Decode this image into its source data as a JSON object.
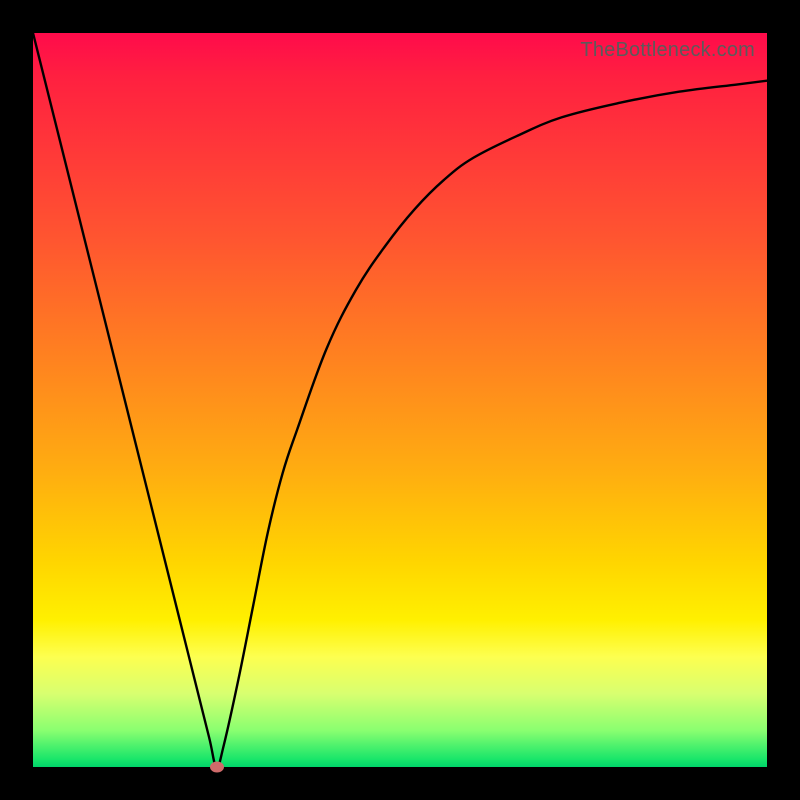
{
  "watermark": "TheBottleneck.com",
  "colors": {
    "frame": "#000000",
    "gradient_top": "#ff0b4b",
    "gradient_bottom": "#00d46a",
    "curve": "#000000",
    "marker": "#cf6a6a"
  },
  "chart_data": {
    "type": "line",
    "title": "",
    "xlabel": "",
    "ylabel": "",
    "xlim": [
      0,
      100
    ],
    "ylim": [
      0,
      100
    ],
    "x": [
      0,
      4,
      8,
      12,
      16,
      20,
      22,
      24,
      25,
      26,
      28,
      30,
      32,
      34,
      36,
      40,
      44,
      48,
      52,
      56,
      60,
      66,
      72,
      80,
      88,
      96,
      100
    ],
    "y": [
      100,
      84,
      68,
      52,
      36,
      20,
      12,
      4,
      0,
      3,
      12,
      22,
      32,
      40,
      46,
      57,
      65,
      71,
      76,
      80,
      83,
      86,
      88.5,
      90.5,
      92,
      93,
      93.5
    ],
    "marker": {
      "x": 25,
      "y": 0
    }
  }
}
